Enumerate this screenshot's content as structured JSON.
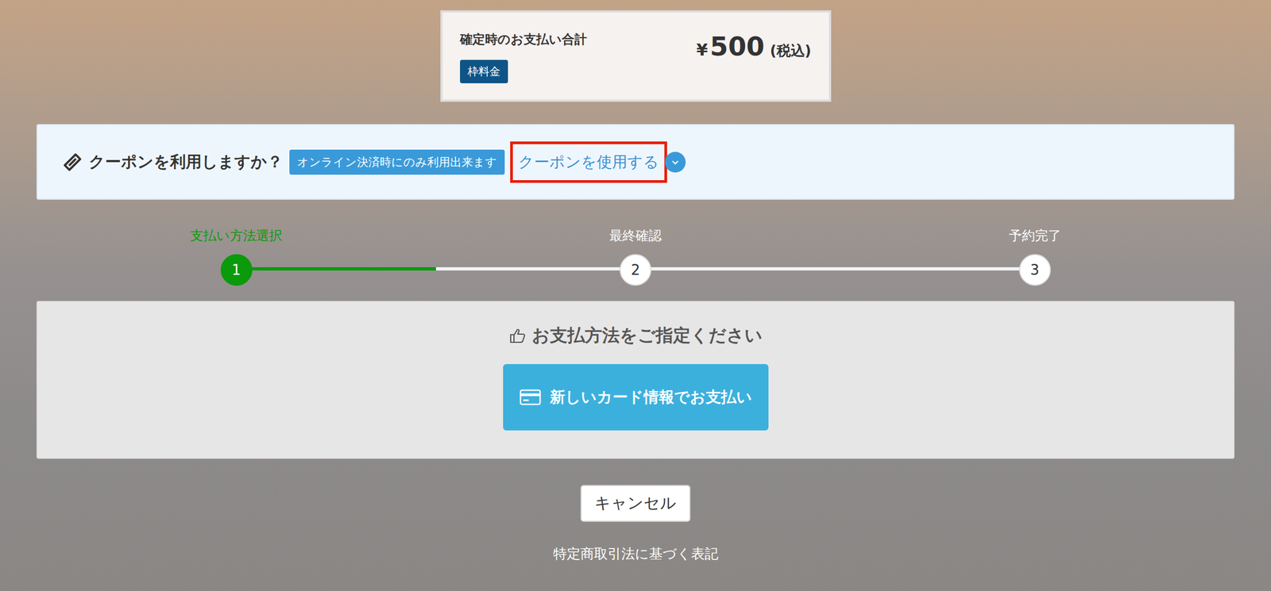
{
  "summary": {
    "label": "確定時のお支払い合計",
    "currency": "¥",
    "amount": "500",
    "tax_note": "(税込)",
    "badge": "枠料金"
  },
  "coupon": {
    "question": "クーポンを利用しますか？",
    "note": "オンライン決済時にのみ利用出来ます",
    "link": "クーポンを使用する",
    "highlighted": true,
    "expanded": false
  },
  "steps": [
    {
      "number": "1",
      "label": "支払い方法選択",
      "selected": true
    },
    {
      "number": "2",
      "label": "最終確認",
      "selected": false
    },
    {
      "number": "3",
      "label": "予約完了",
      "selected": false
    }
  ],
  "progress": {
    "level": 0.25
  },
  "payment": {
    "title": "お支払方法をご指定ください",
    "buttons": [
      "新しいカード情報でお支払い"
    ]
  },
  "cancel": "キャンセル",
  "footer_link": "特定商取引法に基づく表記"
}
